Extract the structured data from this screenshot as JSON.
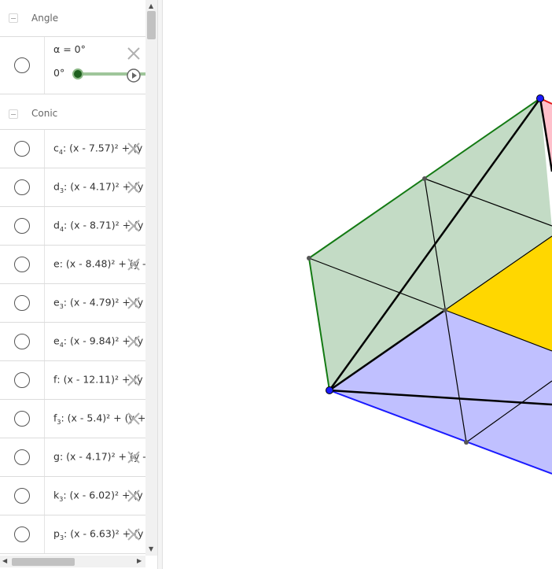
{
  "algebra": {
    "angle_group": {
      "title": "Angle",
      "slider": {
        "definition": "α = 0°",
        "value_label": "0°",
        "value": 0
      }
    },
    "conic_group": {
      "title": "Conic",
      "items": [
        {
          "name": "c",
          "sub": "4",
          "expr": ": (x - 7.57)² + (y"
        },
        {
          "name": "d",
          "sub": "3",
          "expr": ": (x - 4.17)² + (y"
        },
        {
          "name": "d",
          "sub": "4",
          "expr": ": (x - 8.71)² + (y"
        },
        {
          "name": "e",
          "sub": "",
          "expr": ": (x - 8.48)² + (y -"
        },
        {
          "name": "e",
          "sub": "3",
          "expr": ": (x - 4.79)² + (y"
        },
        {
          "name": "e",
          "sub": "4",
          "expr": ": (x - 9.84)² + (y"
        },
        {
          "name": "f",
          "sub": "",
          "expr": ": (x - 12.11)² + (y"
        },
        {
          "name": "f",
          "sub": "3",
          "expr": ": (x - 5.4)² + (y +"
        },
        {
          "name": "g",
          "sub": "",
          "expr": ": (x - 4.17)² + (y -"
        },
        {
          "name": "k",
          "sub": "3",
          "expr": ": (x - 6.02)² + (y"
        },
        {
          "name": "p",
          "sub": "3",
          "expr": ": (x - 6.63)² + (y"
        }
      ]
    }
  },
  "colors": {
    "green_fill": "#c3dbc5",
    "green_stroke": "#137a13",
    "blue_fill": "#c0c0ff",
    "blue_stroke": "#1a1aff",
    "yellow_fill": "#ffd700",
    "pink_fill": "#ffc0cb",
    "slider_thumb": "#1e5f1e"
  }
}
